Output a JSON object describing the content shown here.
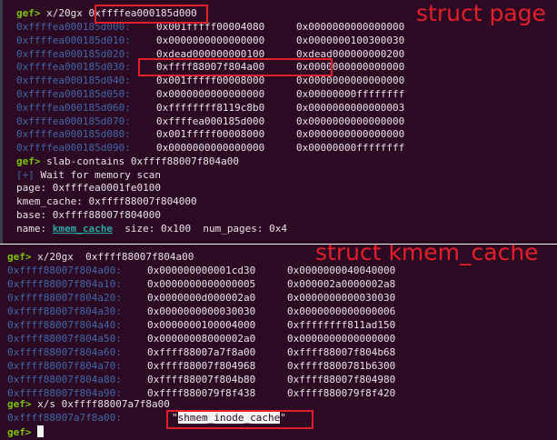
{
  "prompt": "gef>",
  "top": {
    "annotation": "struct page",
    "command": "x/20gx",
    "command_arg": "0xffffea000185d000",
    "rows": [
      [
        "0xffffea000185d000:",
        "0x001fffff00004080",
        "0x0000000000000000"
      ],
      [
        "0xffffea000185d010:",
        "0x0000000000000000",
        "0x0000000100300030"
      ],
      [
        "0xffffea000185d020:",
        "0xdead000000000100",
        "0xdead000000000200"
      ],
      [
        "0xffffea000185d030:",
        "0xffff88007f804a00",
        "0x0000000000000000"
      ],
      [
        "0xffffea000185d040:",
        "0x001fffff00008000",
        "0x0000000000000000"
      ],
      [
        "0xffffea000185d050:",
        "0x0000000000000000",
        "0x00000000ffffffff"
      ],
      [
        "0xffffea000185d060:",
        "0xffffffff8119c8b0",
        "0x0000000000000003"
      ],
      [
        "0xffffea000185d070:",
        "0xffffea000185d000",
        "0x0000000000000000"
      ],
      [
        "0xffffea000185d080:",
        "0x001fffff00008000",
        "0x0000000000000000"
      ],
      [
        "0xffffea000185d090:",
        "0x0000000000000000",
        "0x00000000ffffffff"
      ]
    ],
    "slab_command": "slab-contains 0xffff88007f804a00",
    "wait_marker": "[+]",
    "wait_text": "Wait for memory scan",
    "page_line": "page: 0xffffea0001fe0100",
    "kmem_cache_line": "kmem_cache: 0xffff88007f804000",
    "base_line": "base: 0xffff88007f804000",
    "name_label": "name:",
    "name_value": "kmem_cache",
    "name_rest": "  size: 0x100  num_pages: 0x4"
  },
  "bottom": {
    "annotation": "struct kmem_cache",
    "command": "x/20gx  0xffff88007f804a00",
    "rows": [
      [
        "0xffff88007f804a00:",
        "0x000000000001cd30",
        "0x0000000040040000"
      ],
      [
        "0xffff88007f804a10:",
        "0x0000000000000005",
        "0x000002a0000002a8"
      ],
      [
        "0xffff88007f804a20:",
        "0x0000000d000002a0",
        "0x0000000000030030"
      ],
      [
        "0xffff88007f804a30:",
        "0x0000000000030030",
        "0x0000000000000006"
      ],
      [
        "0xffff88007f804a40:",
        "0x0000000100004000",
        "0xffffffff811ad150"
      ],
      [
        "0xffff88007f804a50:",
        "0x00000008000002a0",
        "0x0000000000000000"
      ],
      [
        "0xffff88007f804a60:",
        "0xffff88007a7f8a00",
        "0xffff88007f804b68"
      ],
      [
        "0xffff88007f804a70:",
        "0xffff88007f804968",
        "0xffff8800781b6300"
      ],
      [
        "0xffff88007f804a80:",
        "0xffff88007f804b80",
        "0xffff88007f804980"
      ],
      [
        "0xffff88007f804a90:",
        "0xffff880079f8f438",
        "0xffff880079f8f420"
      ]
    ],
    "xs_command": "x/s 0xffff88007a7f8a00",
    "string_addr": "0xffff88007a7f8a00:",
    "string_value": "shmem_inode_cache"
  },
  "colors": {
    "background": "#2d0a23",
    "prompt": "#7dc20a",
    "address": "#3f68a8",
    "annotation": "#e41f2a"
  }
}
